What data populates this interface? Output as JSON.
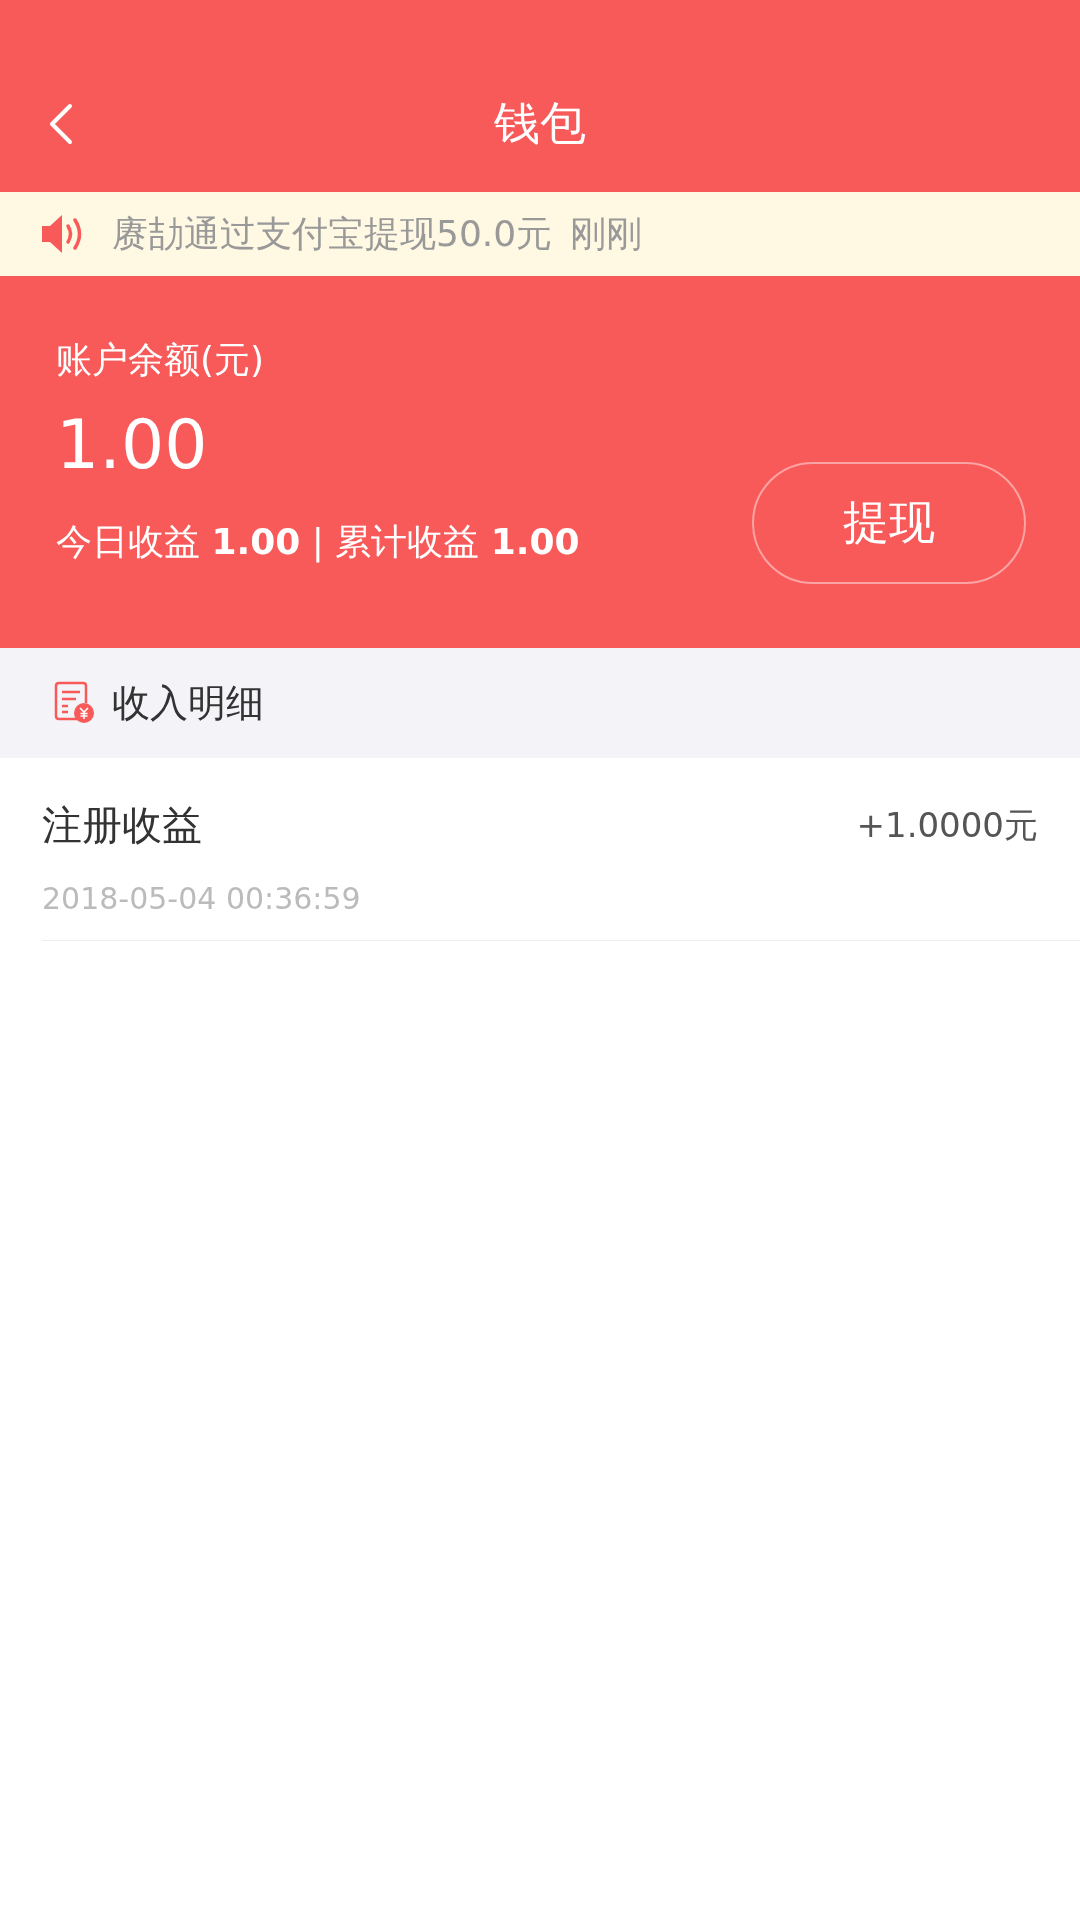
{
  "header": {
    "title": "钱包"
  },
  "notice": {
    "text": "赓劼通过支付宝提现50.0元",
    "time": "刚刚"
  },
  "balance": {
    "label": "账户余额(元)",
    "amount": "1.00",
    "withdraw_button": "提现",
    "stats": "今日收益 **1.00** | 累计收益 **1.00**"
  },
  "section": {
    "title": "收入明细"
  },
  "records": [
    {
      "title": "注册收益",
      "amount": "+1.0000元",
      "time": "2018-05-04 00:36:59"
    }
  ]
}
